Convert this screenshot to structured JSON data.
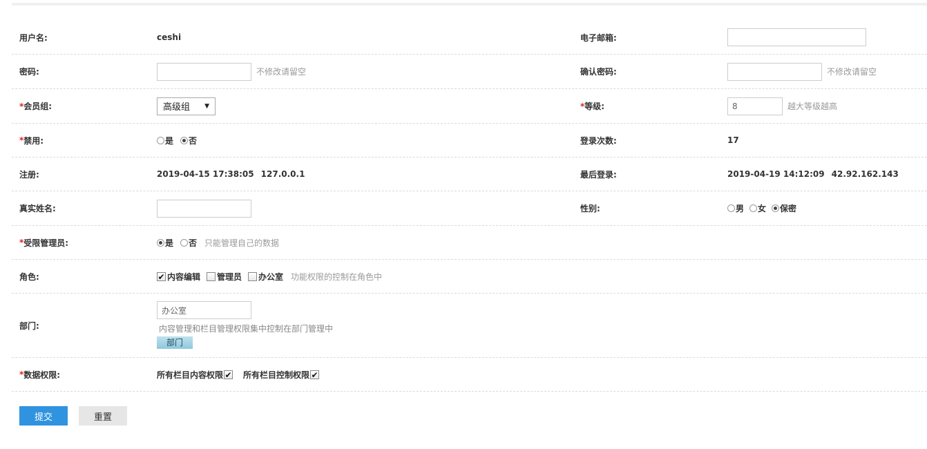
{
  "form": {
    "username": {
      "label": "用户名:",
      "value": "ceshi"
    },
    "email": {
      "label": "电子邮箱:",
      "value": ""
    },
    "password": {
      "label": "密码:",
      "value": "",
      "hint": "不修改请留空"
    },
    "confirm_password": {
      "label": "确认密码:",
      "value": "",
      "hint": "不修改请留空"
    },
    "member_group": {
      "required_mark": "*",
      "label": "会员组:",
      "selected": "高级组"
    },
    "level": {
      "required_mark": "*",
      "label": "等级:",
      "value": "8",
      "hint": "越大等级越高"
    },
    "disabled": {
      "required_mark": "*",
      "label": "禁用:",
      "options": [
        "是",
        "否"
      ],
      "selected": "否"
    },
    "login_count": {
      "label": "登录次数:",
      "value": "17"
    },
    "register": {
      "label": "注册:",
      "datetime": "2019-04-15 17:38:05",
      "ip": "127.0.0.1"
    },
    "last_login": {
      "label": "最后登录:",
      "datetime": "2019-04-19 14:12:09",
      "ip": "42.92.162.143"
    },
    "real_name": {
      "label": "真实姓名:",
      "value": ""
    },
    "gender": {
      "label": "性别:",
      "options": [
        "男",
        "女",
        "保密"
      ],
      "selected": "保密"
    },
    "limited_admin": {
      "required_mark": "*",
      "label": "受限管理员:",
      "options": [
        "是",
        "否"
      ],
      "selected": "是",
      "hint": "只能管理自己的数据"
    },
    "roles": {
      "label": "角色:",
      "options": [
        {
          "label": "内容编辑",
          "checked": true
        },
        {
          "label": "管理员",
          "checked": false
        },
        {
          "label": "办公室",
          "checked": false
        }
      ],
      "hint": "功能权限的控制在角色中"
    },
    "department": {
      "label": "部门:",
      "value": "办公室",
      "hint": "内容管理和栏目管理权限集中控制在部门管理中",
      "button": "部门"
    },
    "data_permission": {
      "required_mark": "*",
      "label": "数据权限:",
      "options": [
        {
          "label": "所有栏目内容权限",
          "checked": true
        },
        {
          "label": "所有栏目控制权限",
          "checked": true
        }
      ]
    }
  },
  "actions": {
    "submit": "提交",
    "reset": "重置"
  }
}
